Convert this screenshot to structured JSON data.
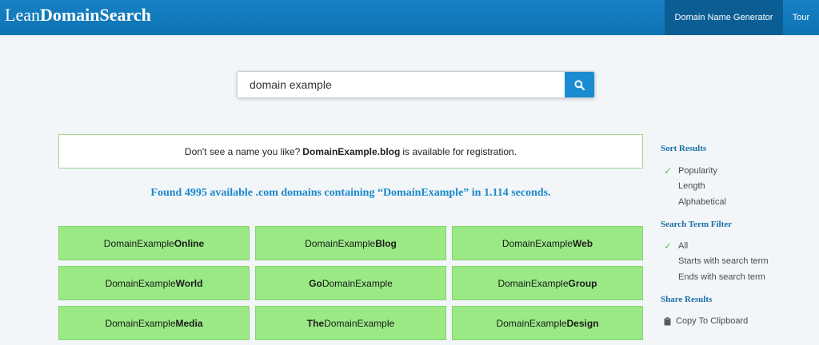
{
  "header": {
    "logo_light": "Lean",
    "logo_bold": "DomainSearch",
    "nav": [
      {
        "label": "Domain Name Generator",
        "active": true
      },
      {
        "label": "Tour",
        "active": false
      }
    ]
  },
  "search": {
    "value": "domain example",
    "button_icon": "search-icon"
  },
  "notice": {
    "prefix": "Don't see a name you like?",
    "domain": "DomainExample.blog",
    "suffix": "is available for registration."
  },
  "results": {
    "summary": "Found 4995 available .com domains containing “DomainExample” in 1.114 seconds.",
    "domains": [
      {
        "pre": "DomainExample",
        "bold": "Online",
        "post": ""
      },
      {
        "pre": "DomainExample",
        "bold": "Blog",
        "post": ""
      },
      {
        "pre": "DomainExample",
        "bold": "Web",
        "post": ""
      },
      {
        "pre": "DomainExample",
        "bold": "World",
        "post": ""
      },
      {
        "pre": "",
        "bold": "Go",
        "post": "DomainExample"
      },
      {
        "pre": "DomainExample",
        "bold": "Group",
        "post": ""
      },
      {
        "pre": "DomainExample",
        "bold": "Media",
        "post": ""
      },
      {
        "pre": "",
        "bold": "The",
        "post": "DomainExample"
      },
      {
        "pre": "DomainExample",
        "bold": "Design",
        "post": ""
      }
    ]
  },
  "sidebar": {
    "sort": {
      "heading": "Sort Results",
      "options": [
        {
          "label": "Popularity",
          "selected": true
        },
        {
          "label": "Length",
          "selected": false
        },
        {
          "label": "Alphabetical",
          "selected": false
        }
      ]
    },
    "filter": {
      "heading": "Search Term Filter",
      "options": [
        {
          "label": "All",
          "selected": true
        },
        {
          "label": "Starts with search term",
          "selected": false
        },
        {
          "label": "Ends with search term",
          "selected": false
        }
      ]
    },
    "share": {
      "heading": "Share Results",
      "copy_label": "Copy To Clipboard",
      "copy_icon": "clipboard-icon"
    }
  },
  "colors": {
    "header": "#1681c4",
    "nav_active": "#0b5e94",
    "accent": "#1a87c9",
    "domain_tile": "#9ae985",
    "check": "#5cbf4a"
  }
}
